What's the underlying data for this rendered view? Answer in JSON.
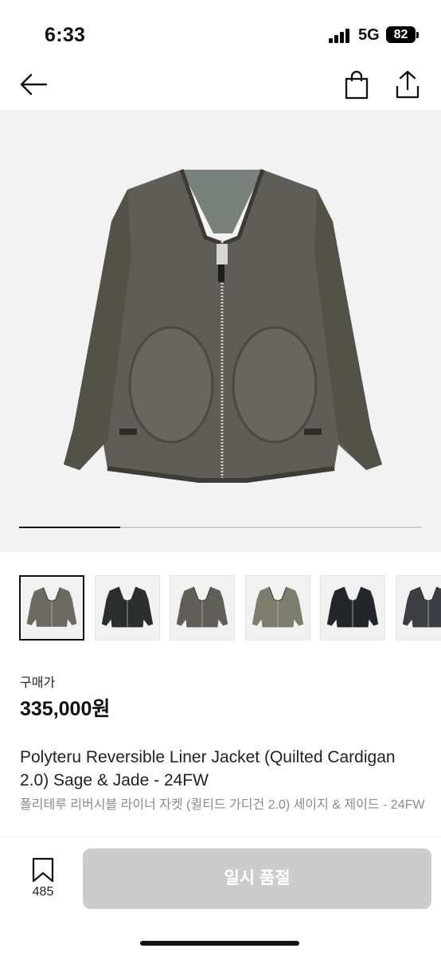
{
  "status_bar": {
    "time": "6:33",
    "network": "5G",
    "battery": "82"
  },
  "nav": {
    "back_icon": "back-arrow-icon",
    "bag_icon": "shopping-bag-icon",
    "share_icon": "share-icon"
  },
  "gallery": {
    "progress": 0.25,
    "thumbnails": [
      {
        "label": "charcoal-front",
        "color": "#6b6a63"
      },
      {
        "label": "black-front",
        "color": "#2b2e2c"
      },
      {
        "label": "charcoal-front-2",
        "color": "#5f5e58"
      },
      {
        "label": "sage-front",
        "color": "#7c7d6d"
      },
      {
        "label": "black-quilted",
        "color": "#23262a"
      },
      {
        "label": "grey-quilted",
        "color": "#3b3f44"
      }
    ]
  },
  "product": {
    "price_label": "구매가",
    "price": "335,000원",
    "title_en": "Polyteru Reversible Liner Jacket (Quilted Cardigan 2.0) Sage & Jade - 24FW",
    "title_ko": "폴리테루 리버시블 라이너 자켓 (퀼티드 가디건 2.0) 세이지 & 제이드 - 24FW"
  },
  "bottom_bar": {
    "bookmark_count": "485",
    "soldout_label": "일시 품절"
  },
  "colors": {
    "button_disabled": "#cccccc",
    "text_secondary": "#8a8a8a"
  }
}
